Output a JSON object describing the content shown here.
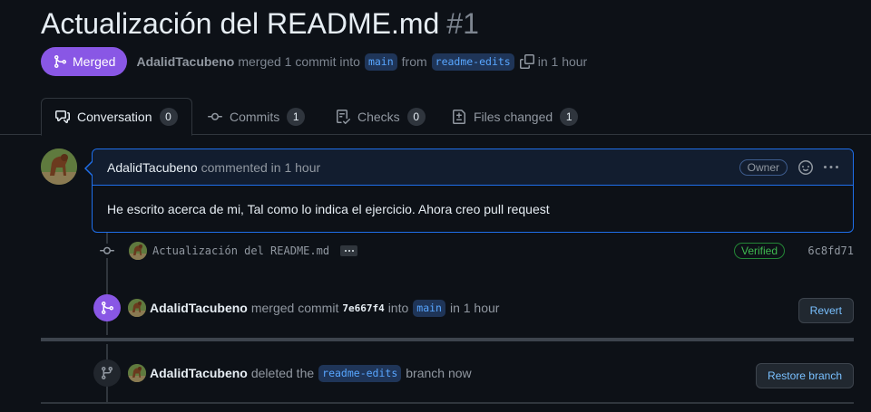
{
  "pr": {
    "title": "Actualización del README.md",
    "number": "#1",
    "state": "Merged",
    "author": "AdalidTacubeno",
    "merged_text": "merged 1 commit into",
    "base_branch": "main",
    "from_text": "from",
    "head_branch": "readme-edits",
    "time_text": "in 1 hour",
    "state_color": "#8957e5"
  },
  "tabs": [
    {
      "label": "Conversation",
      "count": "0",
      "icon": "comment-discussion-icon"
    },
    {
      "label": "Commits",
      "count": "1",
      "icon": "git-commit-icon"
    },
    {
      "label": "Checks",
      "count": "0",
      "icon": "checklist-icon"
    },
    {
      "label": "Files changed",
      "count": "1",
      "icon": "file-diff-icon"
    }
  ],
  "comment": {
    "author": "AdalidTacubeno",
    "meta": "commented in 1 hour",
    "role": "Owner",
    "body": "He escrito acerca de mi, Tal como lo indica el ejercicio. Ahora creo pull request"
  },
  "commit": {
    "message": "Actualización del README.md",
    "verified": "Verified",
    "sha": "6c8fd71"
  },
  "merge_event": {
    "author": "AdalidTacubeno",
    "action": "merged commit",
    "sha": "7e667f4",
    "into": "into",
    "branch": "main",
    "time": "in 1 hour",
    "button": "Revert"
  },
  "delete_event": {
    "author": "AdalidTacubeno",
    "action": "deleted the",
    "branch": "readme-edits",
    "suffix": "branch now",
    "button": "Restore branch"
  }
}
